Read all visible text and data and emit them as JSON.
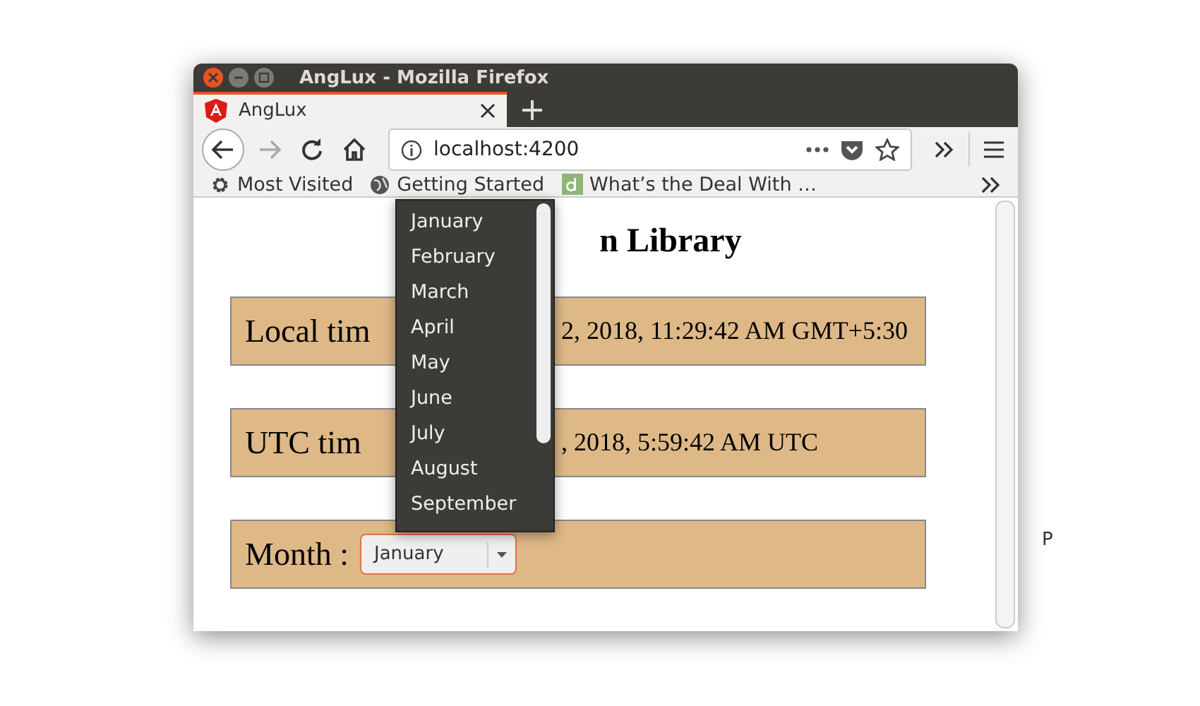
{
  "window": {
    "title": "AngLux - Mozilla Firefox"
  },
  "tabs": [
    {
      "label": "AngLux",
      "selected": true
    }
  ],
  "address_bar": {
    "url": "localhost:4200"
  },
  "bookmarks": [
    "Most Visited",
    "Getting Started",
    "What’s the Deal With …"
  ],
  "page": {
    "heading": "n Library",
    "rows": [
      {
        "label": "Local tim",
        "value": "2, 2018, 11:29:42 AM GMT+5:30",
        "kind": "text"
      },
      {
        "label": "UTC tim",
        "value": ", 2018, 5:59:42 AM UTC",
        "kind": "text"
      },
      {
        "label": "Month :",
        "value": "January",
        "kind": "select"
      }
    ]
  },
  "dropdown": {
    "items": [
      {
        "label": "January",
        "selected": false
      },
      {
        "label": "February",
        "selected": false
      },
      {
        "label": "March",
        "selected": false
      },
      {
        "label": "April",
        "selected": false
      },
      {
        "label": "May",
        "selected": false
      },
      {
        "label": "June",
        "selected": false
      },
      {
        "label": "July",
        "selected": false
      },
      {
        "label": "August",
        "selected": false
      },
      {
        "label": "September",
        "selected": false
      }
    ]
  },
  "stray_text": "P"
}
